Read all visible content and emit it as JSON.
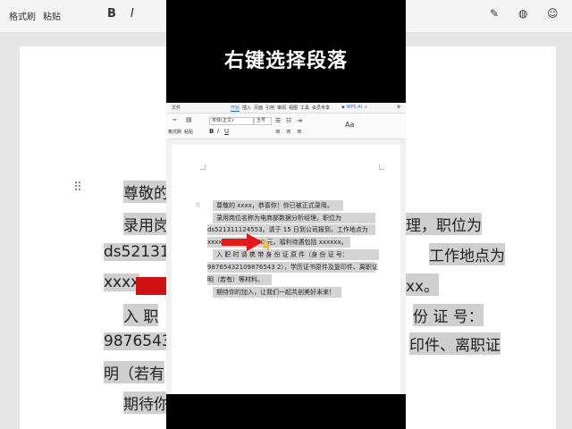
{
  "caption": "右键选择段落",
  "background": {
    "toolbar": {
      "format_painter": "格式刷",
      "paste": "粘贴",
      "bold": "B",
      "italic": "I"
    },
    "lines": [
      "尊敬的",
      "录用岗",
      "理，职位为",
      "ds521311",
      "工作地点为",
      "xxxx",
      "xx。",
      "入 职",
      "份 证 号：",
      "9876543",
      "印件、离职证",
      "明（若有",
      "期待你"
    ]
  },
  "ribbon": {
    "tabs": [
      "文件",
      "开始",
      "插入",
      "页面",
      "引用",
      "审阅",
      "视图",
      "工具",
      "会员专享"
    ],
    "active_tab": "开始",
    "wps_ai": "WPS AI",
    "tools": {
      "format_painter": "格式刷",
      "paste": "粘贴",
      "font_name": "宋体(正文)",
      "font_size": "五号",
      "bold": "B",
      "italic": "I",
      "underline": "U"
    }
  },
  "document": {
    "lines": [
      "尊敬的 xxxx，恭喜你！你已被正式录用。",
      "录用岗位名称为电商部数据分析经理，职位为",
      "ds521311124553。请于 15 日到公司报到，工作地点为",
      "xxxx，薪资 12,000 元，福利待遇包括 xxxxxx。",
      "入 职 时 请 携 带 身 份 证 原 件（身 份 证 号：",
      "98765432109876543 2），学历证书原件及复印件、离职证",
      "明（若有）等材料。",
      "期待你的加入，让我们一起共创美好未来！"
    ]
  },
  "colors": {
    "arrow": "#e21a1a",
    "highlight": "#d4d4d4",
    "accent": "#2a6be0"
  }
}
